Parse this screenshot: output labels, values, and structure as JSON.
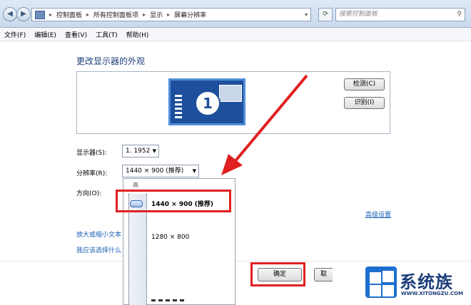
{
  "address_bar": {
    "crumbs": [
      "控制面板",
      "所有控制面板项",
      "显示",
      "屏幕分辨率"
    ]
  },
  "search": {
    "placeholder": "搜索控制面板"
  },
  "menu": {
    "items": [
      "文件(F)",
      "编辑(E)",
      "查看(V)",
      "工具(T)",
      "帮助(H)"
    ]
  },
  "main": {
    "heading": "更改显示器的外观",
    "monitor_number": "1",
    "detect_button": "检测(C)",
    "identify_button": "识别(I)",
    "display_label": "显示器(S):",
    "display_value": "1. 1952",
    "resolution_label": "分辨率(R):",
    "resolution_value": "1440 × 900 (推荐)",
    "orientation_label": "方向(O):",
    "advanced_link": "高级设置",
    "link_zoom": "放大或缩小文本",
    "link_help": "我应该选择什么"
  },
  "dropdown": {
    "top_tick_label": "高",
    "option_recommended": "1440 × 900 (推荐)",
    "option_2": "1280 × 800"
  },
  "footer": {
    "ok_button": "确定",
    "cancel_button": "取"
  },
  "watermark": {
    "brand": "系统族",
    "url": "WWW.XITONGZU.COM"
  },
  "colors": {
    "annotation_red": "#e02020",
    "link_blue": "#1a5fb4",
    "monitor_blue": "#1d4f9c"
  }
}
